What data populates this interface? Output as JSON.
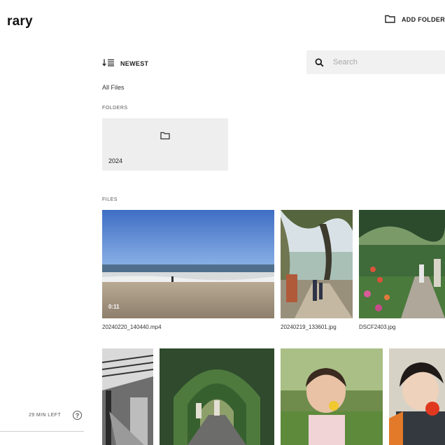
{
  "header": {
    "title": "rary",
    "add_folder_label": "ADD FOLDER"
  },
  "toolbar": {
    "sort_label": "NEWEST",
    "search_placeholder": "Search"
  },
  "breadcrumb": "All Files",
  "folders_section": {
    "label": "FOLDERS",
    "items": [
      {
        "name": "2024"
      }
    ]
  },
  "files_section": {
    "label": "FILES",
    "items": [
      {
        "name": "20240220_140440.mp4",
        "duration": "0:11"
      },
      {
        "name": "20240219_133601.jpg"
      },
      {
        "name": "DSCF2403.jpg"
      },
      {
        "name": ""
      },
      {
        "name": ""
      },
      {
        "name": ""
      },
      {
        "name": ""
      }
    ]
  },
  "sidebar": {
    "storage_text": "29 MIN LEFT",
    "help_label": "?"
  },
  "icons": [
    "sort-icon",
    "folder-icon",
    "search-icon",
    "help-icon"
  ]
}
